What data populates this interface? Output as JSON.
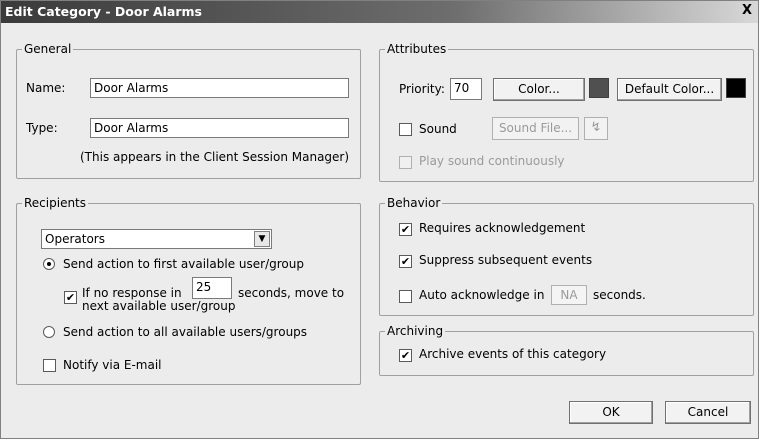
{
  "window": {
    "title": "Edit Category - Door Alarms",
    "close_label": "X"
  },
  "general": {
    "legend": "General",
    "name_label": "Name:",
    "name_value": "Door Alarms",
    "type_label": "Type:",
    "type_value": "Door Alarms",
    "note": "(This appears in the Client Session Manager)"
  },
  "attributes": {
    "legend": "Attributes",
    "priority_label": "Priority:",
    "priority_value": "70",
    "color_button": "Color...",
    "color_swatch": "#505050",
    "default_color_button": "Default Color...",
    "default_color_swatch": "#000000",
    "sound_label": "Sound",
    "sound_checked": false,
    "sound_file_button": "Sound File...",
    "play_label": "Play sound continuously",
    "play_checked": false
  },
  "recipients": {
    "legend": "Recipients",
    "selected": "Operators",
    "send_first_label": "Send action to first available user/group",
    "no_response_prefix": "If no response in",
    "no_response_value": "25",
    "no_response_suffix": "seconds, move to",
    "no_response_line2": "next available user/group",
    "no_response_checked": true,
    "send_all_label": "Send action to all available users/groups",
    "selected_radio": "first",
    "notify_label": "Notify via E-mail",
    "notify_checked": false
  },
  "behavior": {
    "legend": "Behavior",
    "requires_ack_label": "Requires acknowledgement",
    "requires_ack_checked": true,
    "suppress_label": "Suppress subsequent events",
    "suppress_checked": true,
    "auto_ack_prefix": "Auto acknowledge in",
    "auto_ack_value": "NA",
    "auto_ack_suffix": "seconds.",
    "auto_ack_checked": false
  },
  "archiving": {
    "legend": "Archiving",
    "archive_label": "Archive events of this category",
    "archive_checked": true
  },
  "footer": {
    "ok": "OK",
    "cancel": "Cancel"
  }
}
